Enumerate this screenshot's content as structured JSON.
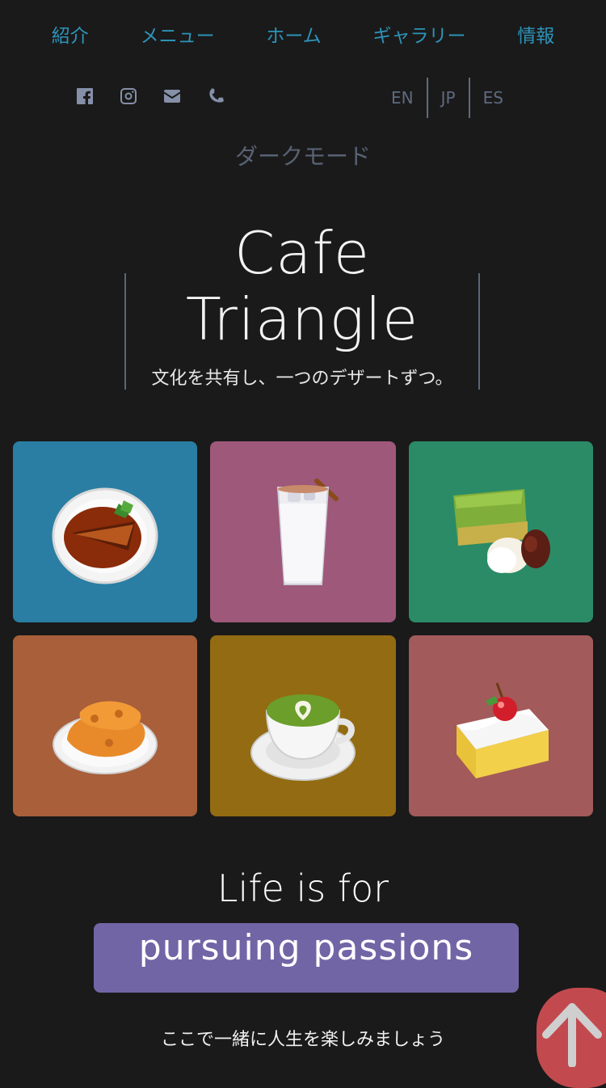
{
  "nav": {
    "items": [
      {
        "label": "紹介"
      },
      {
        "label": "メニュー"
      },
      {
        "label": "ホーム"
      },
      {
        "label": "ギャラリー"
      },
      {
        "label": "情報"
      }
    ]
  },
  "social": {
    "icons": [
      "facebook-icon",
      "instagram-icon",
      "email-icon",
      "phone-icon"
    ]
  },
  "languages": [
    "EN",
    "JP",
    "ES"
  ],
  "dark_mode_label": "ダークモード",
  "hero": {
    "title_line1": "Cafe",
    "title_line2": "Triangle",
    "tagline": "文化を共有し、一つのデザートずつ。"
  },
  "gallery": {
    "tiles": [
      {
        "icon": "caramel-cake-icon",
        "color": "#2a7ea3"
      },
      {
        "icon": "iced-chai-icon",
        "color": "#9e5879"
      },
      {
        "icon": "matcha-cake-icon",
        "color": "#2a8b66"
      },
      {
        "icon": "taiyaki-icon",
        "color": "#a85f3a"
      },
      {
        "icon": "matcha-latte-icon",
        "color": "#936b12"
      },
      {
        "icon": "cherry-cake-icon",
        "color": "#a35a5a"
      }
    ]
  },
  "life": {
    "line1": "Life is for",
    "highlight": "pursuing passions",
    "sub": "ここで一緒に人生を楽しみましょう"
  },
  "colors": {
    "background": "#1a1a1a",
    "nav": "#2d93b8",
    "highlight": "#7265a6",
    "to_top": "#c24a4f"
  }
}
